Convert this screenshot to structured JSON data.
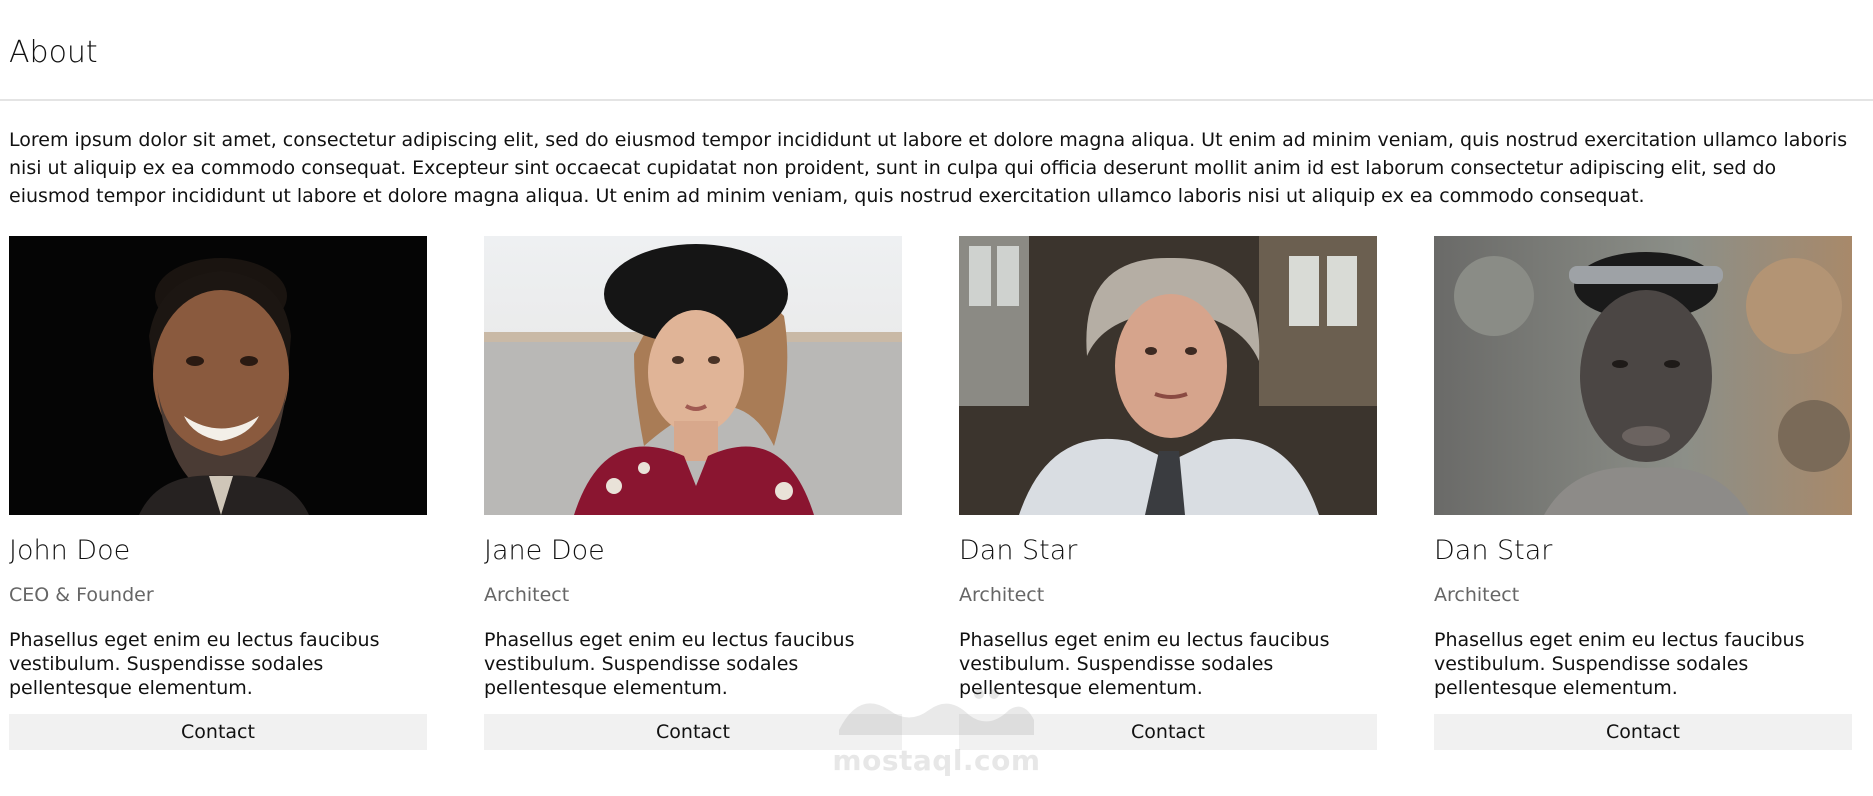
{
  "header": {
    "title": "About"
  },
  "intro": {
    "text": "Lorem ipsum dolor sit amet, consectetur adipiscing elit, sed do eiusmod tempor incididunt ut labore et dolore magna aliqua. Ut enim ad minim veniam, quis nostrud exercitation ullamco laboris nisi ut aliquip ex ea commodo consequat. Excepteur sint occaecat cupidatat non proident, sunt in culpa qui officia deserunt mollit anim id est laborum consectetur adipiscing elit, sed do eiusmod tempor incididunt ut labore et dolore magna aliqua. Ut enim ad minim veniam, quis nostrud exercitation ullamco laboris nisi ut aliquip ex ea commodo consequat."
  },
  "team": [
    {
      "name": "John Doe",
      "role": "CEO & Founder",
      "description": "Phasellus eget enim eu lectus faucibus vestibulum. Suspendisse sodales pellentesque elementum.",
      "contact_label": "Contact",
      "photo": "portrait-man-beard-dark-background"
    },
    {
      "name": "Jane Doe",
      "role": "Architect",
      "description": "Phasellus eget enim eu lectus faucibus vestibulum. Suspendisse sodales pellentesque elementum.",
      "contact_label": "Contact",
      "photo": "portrait-woman-black-hat-desert"
    },
    {
      "name": "Dan Star",
      "role": "Architect",
      "description": "Phasellus eget enim eu lectus faucibus vestibulum. Suspendisse sodales pellentesque elementum.",
      "contact_label": "Contact",
      "photo": "portrait-older-man-grey-hair-workshop"
    },
    {
      "name": "Dan Star",
      "role": "Architect",
      "description": "Phasellus eget enim eu lectus faucibus vestibulum. Suspendisse sodales pellentesque elementum.",
      "contact_label": "Contact",
      "photo": "portrait-young-man-sunglasses-on-head"
    }
  ],
  "watermark": {
    "text": "mostaql.com"
  },
  "colors": {
    "contact_bg": "#f1f1f1",
    "role_text": "#666666",
    "divider": "#e4e4e4"
  }
}
